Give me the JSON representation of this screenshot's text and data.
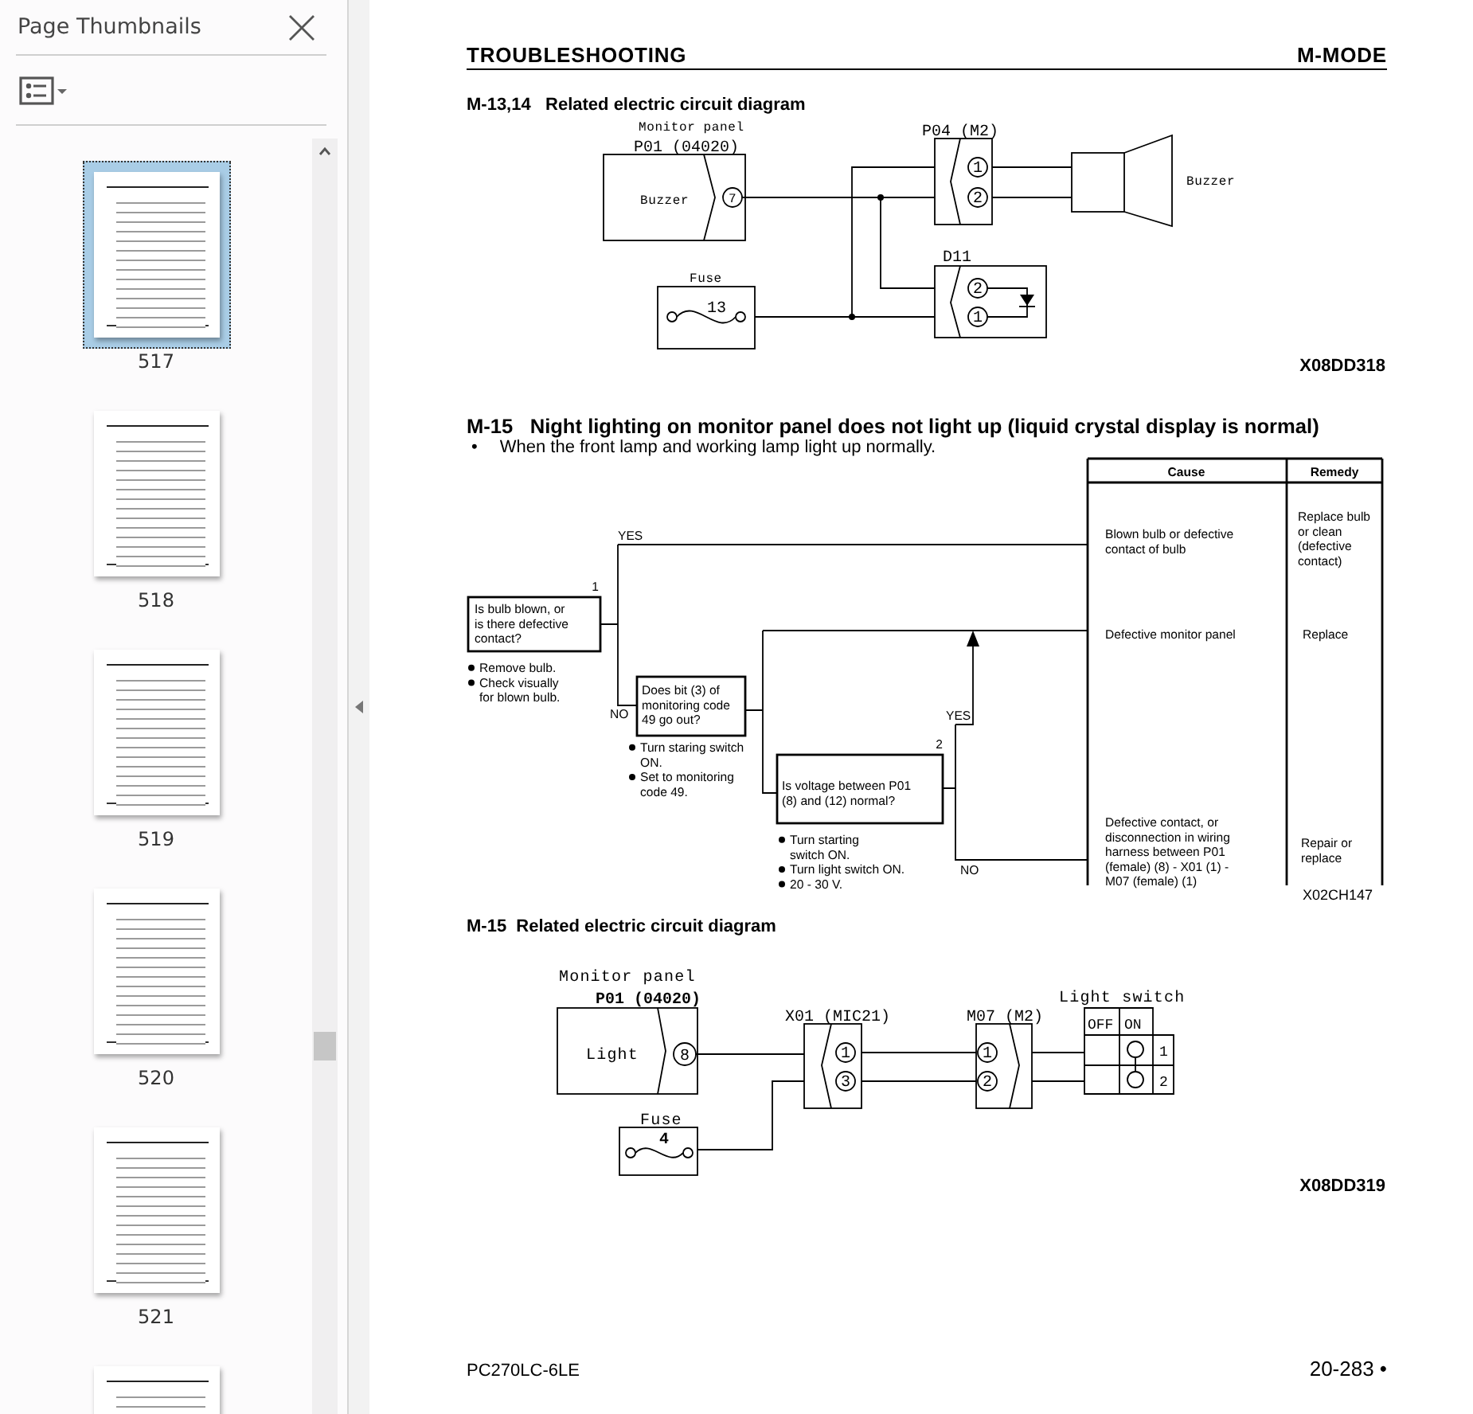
{
  "sidebar": {
    "title": "Page Thumbnails",
    "thumbnails": [
      {
        "page": "517",
        "selected": true
      },
      {
        "page": "518",
        "selected": false
      },
      {
        "page": "519",
        "selected": false
      },
      {
        "page": "520",
        "selected": false
      },
      {
        "page": "521",
        "selected": false
      },
      {
        "selected": false
      }
    ]
  },
  "document": {
    "header": {
      "left": "TROUBLESHOOTING",
      "right": "M-MODE"
    },
    "circuit_diagram_1": {
      "title": "M-13,14   Related electric circuit diagram",
      "monitor": {
        "caption": "Monitor panel",
        "connector": "P01 (04020)",
        "function": "Buzzer",
        "pin": "7"
      },
      "connector_p04": {
        "label": "P04 (M2)",
        "pins": [
          "1",
          "2"
        ]
      },
      "buzzer": {
        "label": "Buzzer"
      },
      "diode": {
        "label": "D11",
        "pins": [
          "2",
          "1"
        ]
      },
      "fuse": {
        "label": "Fuse",
        "number": "13"
      },
      "figure_code": "X08DD318"
    },
    "troubleshooting": {
      "title": "M-15   Night lighting on monitor panel does not light up (liquid crystal display is normal)",
      "condition_marker": "•",
      "condition": "When the front lamp and working lamp light up normally.",
      "table_header": {
        "cause": "Cause",
        "remedy": "Remedy"
      },
      "steps": [
        {
          "number": "1",
          "question": [
            "Is bulb blown, or",
            "is there defective",
            "contact?"
          ],
          "yes": "YES",
          "no": "NO",
          "notes": [
            [
              "Remove bulb."
            ],
            [
              "Check visually",
              "for blown bulb."
            ]
          ]
        },
        {
          "question": [
            "Does bit (3) of",
            "monitoring code",
            "49 go out?"
          ],
          "notes": [
            [
              "Turn staring switch",
              "ON."
            ],
            [
              "Set to monitoring",
              "code 49."
            ]
          ]
        },
        {
          "number": "2",
          "question": [
            "Is voltage between P01",
            "(8) and (12) normal?"
          ],
          "yes": "YES",
          "no": "NO",
          "notes": [
            [
              "Turn starting",
              "switch ON."
            ],
            [
              "Turn light switch ON."
            ],
            [
              "20 - 30 V."
            ]
          ]
        }
      ],
      "results": [
        {
          "cause": [
            "Blown bulb or defective",
            "contact of bulb"
          ],
          "remedy": [
            "Replace bulb",
            "or clean",
            "(defective",
            "contact)"
          ]
        },
        {
          "cause": [
            "Defective monitor panel"
          ],
          "remedy": [
            "Replace"
          ]
        },
        {
          "cause": [
            "Defective contact, or",
            "disconnection in wiring",
            "harness between P01",
            "(female) (8) - X01 (1) -",
            "M07 (female) (1)"
          ],
          "remedy": [
            "Repair or",
            "replace"
          ]
        }
      ],
      "figure_code": "X02CH147"
    },
    "circuit_diagram_2": {
      "title": "M-15  Related electric circuit diagram",
      "monitor": {
        "caption": "Monitor panel",
        "connector": "P01 (04020)",
        "function": "Light",
        "pin": "8"
      },
      "connector_x01": {
        "label": "X01 (MIC21)",
        "pins": [
          "1",
          "3"
        ]
      },
      "connector_m07": {
        "label": "M07 (M2)",
        "pins": [
          "1",
          "2"
        ]
      },
      "light_switch": {
        "label": "Light switch",
        "positions": [
          "OFF",
          "ON"
        ],
        "terminals": [
          "1",
          "2"
        ]
      },
      "fuse": {
        "label": "Fuse",
        "number": "4"
      },
      "figure_code": "X08DD319"
    },
    "footer": {
      "model": "PC270LC-6LE",
      "page": "20-283 •"
    }
  }
}
